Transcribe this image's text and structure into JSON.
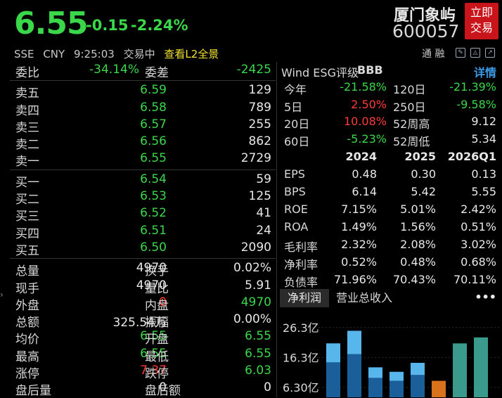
{
  "header": {
    "price": "6.55",
    "change": "-0.15",
    "change_pct": "-2.24%",
    "name": "厦门象屿",
    "code": "600057",
    "trade_btn_line1": "立即",
    "trade_btn_line2": "交易",
    "exchange": "SSE",
    "currency": "CNY",
    "time": "9:25:03",
    "status": "交易中",
    "l2_link": "查看L2全景",
    "right_label": "通  融"
  },
  "weibi": {
    "label1": "委比",
    "value1": "-34.14%",
    "label2": "委差",
    "value2": "-2425"
  },
  "asks": [
    {
      "label": "卖五",
      "price": "6.59",
      "vol": "129"
    },
    {
      "label": "卖四",
      "price": "6.58",
      "vol": "789"
    },
    {
      "label": "卖三",
      "price": "6.57",
      "vol": "255"
    },
    {
      "label": "卖二",
      "price": "6.56",
      "vol": "862"
    },
    {
      "label": "卖一",
      "price": "6.55",
      "vol": "2729"
    }
  ],
  "bids": [
    {
      "label": "买一",
      "price": "6.54",
      "vol": "59"
    },
    {
      "label": "买二",
      "price": "6.53",
      "vol": "125"
    },
    {
      "label": "买三",
      "price": "6.52",
      "vol": "41"
    },
    {
      "label": "买四",
      "price": "6.51",
      "vol": "24"
    },
    {
      "label": "买五",
      "price": "6.50",
      "vol": "2090"
    }
  ],
  "stats": [
    {
      "l1": "总量",
      "v1": "4970",
      "c1": "white",
      "l2": "换手",
      "v2": "0.02%",
      "c2": "white"
    },
    {
      "l1": "现手",
      "v1": "4970",
      "c1": "white",
      "l2": "量比",
      "v2": "5.91",
      "c2": "white"
    },
    {
      "l1": "外盘",
      "v1": "0",
      "c1": "red",
      "l2": "内盘",
      "v2": "4970",
      "c2": "green"
    },
    {
      "l1": "总额",
      "v1": "325.54万",
      "c1": "white",
      "l2": "振幅",
      "v2": "0.00%",
      "c2": "white"
    },
    {
      "l1": "均价",
      "v1": "6.55",
      "c1": "green",
      "l2": "开盘",
      "v2": "6.55",
      "c2": "green"
    },
    {
      "l1": "最高",
      "v1": "6.55",
      "c1": "green",
      "l2": "最低",
      "v2": "6.55",
      "c2": "green"
    },
    {
      "l1": "涨停",
      "v1": "7.37",
      "c1": "red",
      "l2": "跌停",
      "v2": "6.03",
      "c2": "green"
    },
    {
      "l1": "盘后量",
      "v1": "0",
      "c1": "white",
      "l2": "盘后额",
      "v2": "0",
      "c2": "white"
    }
  ],
  "esg": {
    "label": "Wind ESG评级",
    "grade": "BBB",
    "detail": "详情"
  },
  "performance": [
    {
      "l1": "今年",
      "v1": "-21.58%",
      "c1": "green",
      "l2": "120日",
      "v2": "-21.39%",
      "c2": "green"
    },
    {
      "l1": "5日",
      "v1": "2.50%",
      "c1": "red",
      "l2": "250日",
      "v2": "-9.58%",
      "c2": "green"
    },
    {
      "l1": "20日",
      "v1": "10.08%",
      "c1": "red",
      "l2": "52周高",
      "v2": "9.12",
      "c2": "white"
    },
    {
      "l1": "60日",
      "v1": "-5.23%",
      "c1": "green",
      "l2": "52周低",
      "v2": "5.34",
      "c2": "white"
    }
  ],
  "fin_headers": [
    "2024",
    "2025",
    "2026Q1"
  ],
  "financials": [
    {
      "label": "EPS",
      "v": [
        "0.48",
        "0.30",
        "0.13"
      ]
    },
    {
      "label": "BPS",
      "v": [
        "6.14",
        "5.42",
        "5.55"
      ]
    },
    {
      "label": "ROE",
      "v": [
        "7.15%",
        "5.01%",
        "2.42%"
      ]
    },
    {
      "label": "ROA",
      "v": [
        "1.49%",
        "1.56%",
        "0.51%"
      ]
    },
    {
      "label": "毛利率",
      "v": [
        "2.32%",
        "2.08%",
        "3.02%"
      ]
    },
    {
      "label": "净利率",
      "v": [
        "0.52%",
        "0.48%",
        "0.68%"
      ]
    },
    {
      "label": "负债率",
      "v": [
        "71.96%",
        "70.43%",
        "70.11%"
      ]
    }
  ],
  "tabs": {
    "net_profit": "净利润",
    "revenue": "营业总收入",
    "more": "•••"
  },
  "chart_data": {
    "type": "bar",
    "y_ticks": [
      "26.3亿",
      "16.3亿",
      "6.30亿"
    ],
    "y_tick_values": [
      26.3,
      16.3,
      6.3
    ],
    "ylim": [
      3.0,
      30.0
    ],
    "series": [
      {
        "values": [
          21.0,
          25.2,
          13.0,
          11.5,
          14.5,
          0,
          0,
          0
        ],
        "color": "#1a5f9a"
      },
      {
        "values": [
          0,
          0,
          0,
          0,
          0,
          8.5,
          0,
          0
        ],
        "color": "#d9731b"
      },
      {
        "values": [
          0,
          0,
          0,
          0,
          0,
          0,
          21.0,
          23.0
        ],
        "color": "#3a9a8c"
      }
    ],
    "color_light": "#57b6ec"
  }
}
